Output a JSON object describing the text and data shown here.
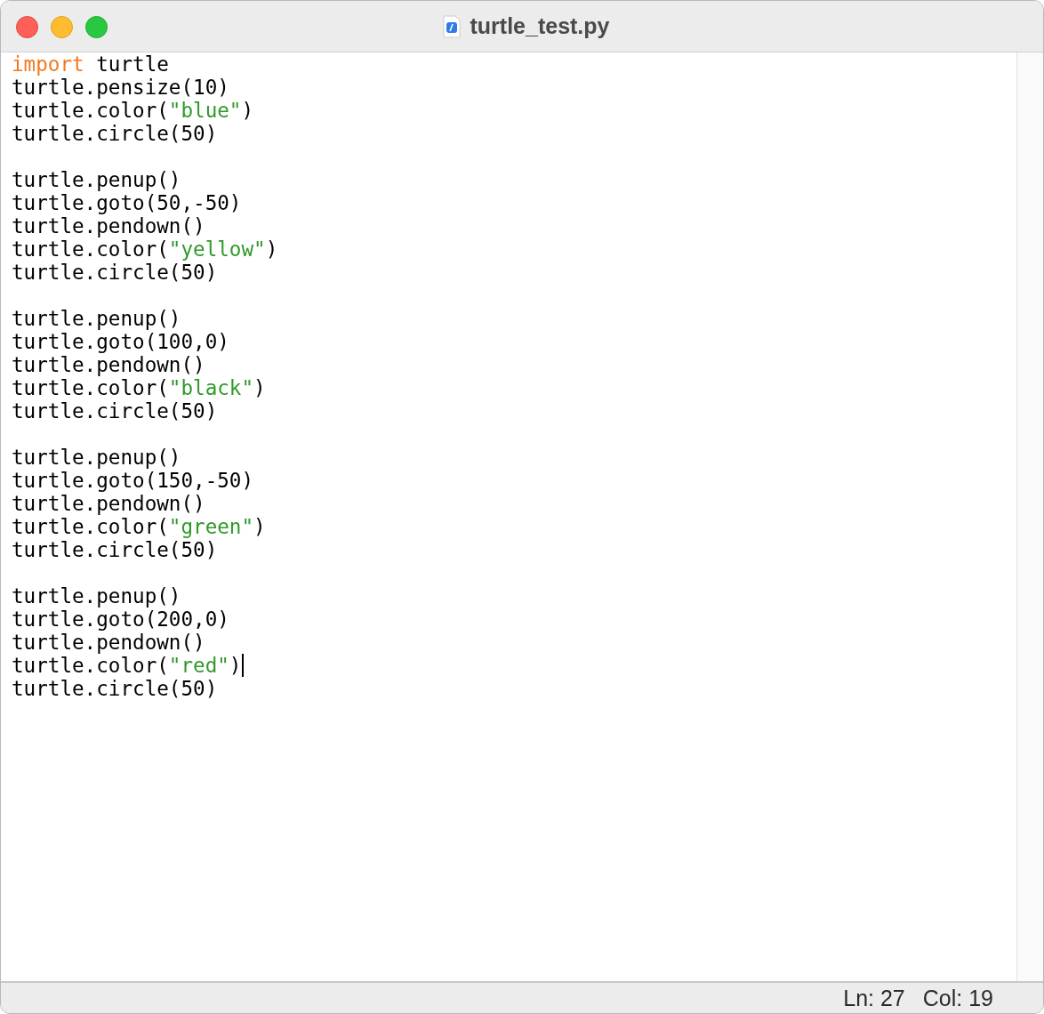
{
  "window": {
    "title": "turtle_test.py"
  },
  "editor": {
    "lines": [
      {
        "kind": "code",
        "caret": false,
        "tokens": [
          {
            "kind": "keyword",
            "text": "import"
          },
          {
            "kind": "plain",
            "text": " turtle"
          }
        ]
      },
      {
        "kind": "code",
        "caret": false,
        "tokens": [
          {
            "kind": "plain",
            "text": "turtle.pensize(10)"
          }
        ]
      },
      {
        "kind": "code",
        "caret": false,
        "tokens": [
          {
            "kind": "plain",
            "text": "turtle.color("
          },
          {
            "kind": "string",
            "text": "\"blue\""
          },
          {
            "kind": "plain",
            "text": ")"
          }
        ]
      },
      {
        "kind": "code",
        "caret": false,
        "tokens": [
          {
            "kind": "plain",
            "text": "turtle.circle(50)"
          }
        ]
      },
      {
        "kind": "blank"
      },
      {
        "kind": "code",
        "caret": false,
        "tokens": [
          {
            "kind": "plain",
            "text": "turtle.penup()"
          }
        ]
      },
      {
        "kind": "code",
        "caret": false,
        "tokens": [
          {
            "kind": "plain",
            "text": "turtle.goto(50,-50)"
          }
        ]
      },
      {
        "kind": "code",
        "caret": false,
        "tokens": [
          {
            "kind": "plain",
            "text": "turtle.pendown()"
          }
        ]
      },
      {
        "kind": "code",
        "caret": false,
        "tokens": [
          {
            "kind": "plain",
            "text": "turtle.color("
          },
          {
            "kind": "string",
            "text": "\"yellow\""
          },
          {
            "kind": "plain",
            "text": ")"
          }
        ]
      },
      {
        "kind": "code",
        "caret": false,
        "tokens": [
          {
            "kind": "plain",
            "text": "turtle.circle(50)"
          }
        ]
      },
      {
        "kind": "blank"
      },
      {
        "kind": "code",
        "caret": false,
        "tokens": [
          {
            "kind": "plain",
            "text": "turtle.penup()"
          }
        ]
      },
      {
        "kind": "code",
        "caret": false,
        "tokens": [
          {
            "kind": "plain",
            "text": "turtle.goto(100,0)"
          }
        ]
      },
      {
        "kind": "code",
        "caret": false,
        "tokens": [
          {
            "kind": "plain",
            "text": "turtle.pendown()"
          }
        ]
      },
      {
        "kind": "code",
        "caret": false,
        "tokens": [
          {
            "kind": "plain",
            "text": "turtle.color("
          },
          {
            "kind": "string",
            "text": "\"black\""
          },
          {
            "kind": "plain",
            "text": ")"
          }
        ]
      },
      {
        "kind": "code",
        "caret": false,
        "tokens": [
          {
            "kind": "plain",
            "text": "turtle.circle(50)"
          }
        ]
      },
      {
        "kind": "blank"
      },
      {
        "kind": "code",
        "caret": false,
        "tokens": [
          {
            "kind": "plain",
            "text": "turtle.penup()"
          }
        ]
      },
      {
        "kind": "code",
        "caret": false,
        "tokens": [
          {
            "kind": "plain",
            "text": "turtle.goto(150,-50)"
          }
        ]
      },
      {
        "kind": "code",
        "caret": false,
        "tokens": [
          {
            "kind": "plain",
            "text": "turtle.pendown()"
          }
        ]
      },
      {
        "kind": "code",
        "caret": false,
        "tokens": [
          {
            "kind": "plain",
            "text": "turtle.color("
          },
          {
            "kind": "string",
            "text": "\"green\""
          },
          {
            "kind": "plain",
            "text": ")"
          }
        ]
      },
      {
        "kind": "code",
        "caret": false,
        "tokens": [
          {
            "kind": "plain",
            "text": "turtle.circle(50)"
          }
        ]
      },
      {
        "kind": "blank"
      },
      {
        "kind": "code",
        "caret": false,
        "tokens": [
          {
            "kind": "plain",
            "text": "turtle.penup()"
          }
        ]
      },
      {
        "kind": "code",
        "caret": false,
        "tokens": [
          {
            "kind": "plain",
            "text": "turtle.goto(200,0)"
          }
        ]
      },
      {
        "kind": "code",
        "caret": false,
        "tokens": [
          {
            "kind": "plain",
            "text": "turtle.pendown()"
          }
        ]
      },
      {
        "kind": "code",
        "caret": true,
        "tokens": [
          {
            "kind": "plain",
            "text": "turtle.color("
          },
          {
            "kind": "string",
            "text": "\"red\""
          },
          {
            "kind": "plain",
            "text": ")"
          }
        ]
      },
      {
        "kind": "code",
        "caret": false,
        "tokens": [
          {
            "kind": "plain",
            "text": "turtle.circle(50)"
          }
        ]
      }
    ]
  },
  "status_bar": {
    "line": "Ln: 27",
    "column": "Col: 19"
  }
}
